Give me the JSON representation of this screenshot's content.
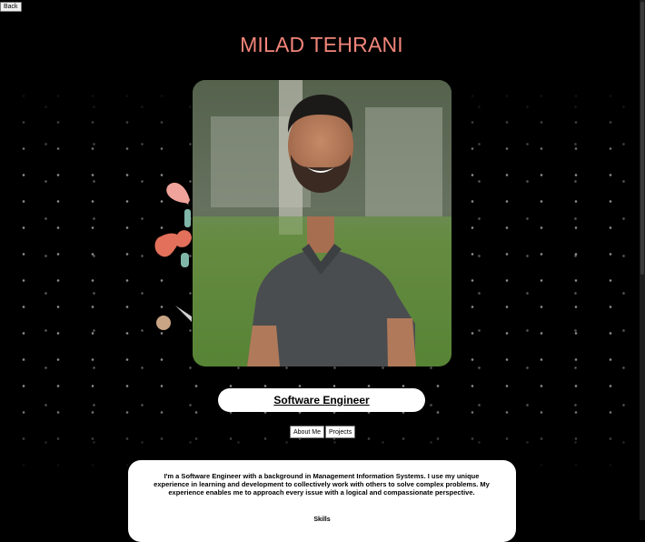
{
  "nav": {
    "back_label": "Back"
  },
  "header": {
    "name": "MILAD TEHRANI"
  },
  "profile": {
    "title": "Software Engineer"
  },
  "buttons": {
    "about_label": "About Me",
    "projects_label": "Projects"
  },
  "about": {
    "text": "I'm a Software Engineer with a background in Management Information Systems. I use my unique experience in learning and development to collectively work with others to solve complex problems. My experience enables me to approach every issue with a logical and compassionate perspective.",
    "skills_label": "Skills"
  },
  "colors": {
    "background": "#000000",
    "name_accent": "#f2857a",
    "deco_coral": "#e2705a",
    "deco_pink": "#f0a39a",
    "deco_teal": "#7fb6a8",
    "deco_tan": "#c9a585"
  }
}
